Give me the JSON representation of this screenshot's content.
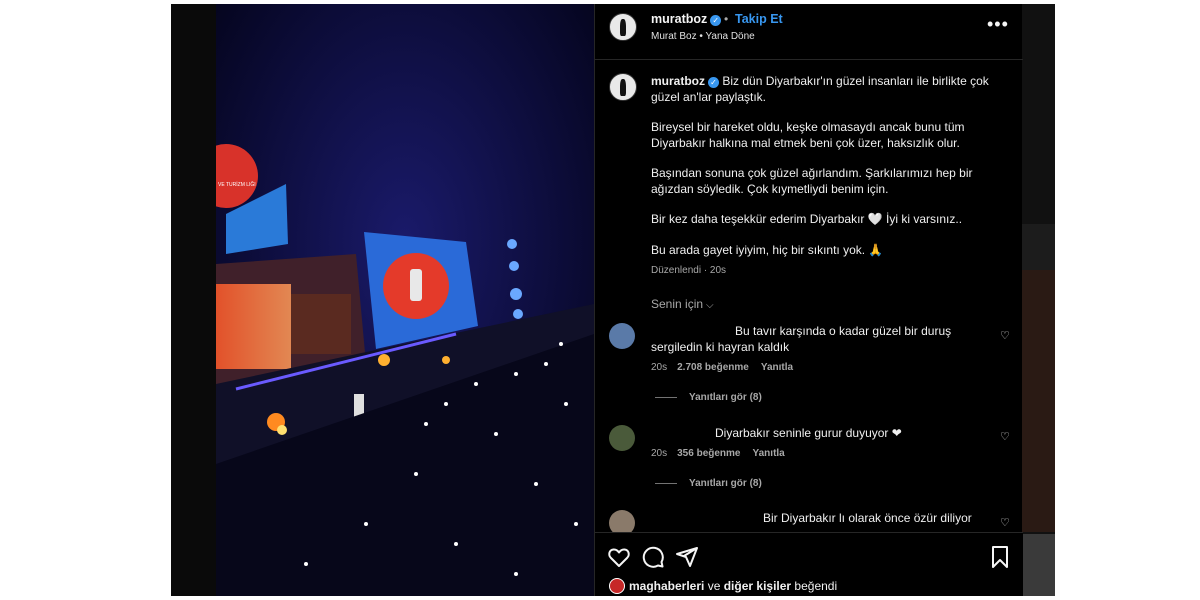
{
  "post": {
    "username": "muratboz",
    "follow_label": "Takip Et",
    "header_sub": "Murat Boz • Yana Döne",
    "more_label": "•••"
  },
  "caption": {
    "username": "muratboz",
    "paragraphs": [
      "Biz dün Diyarbakır'ın güzel insanları ile birlikte çok güzel an'lar paylaştık.",
      "Bireysel bir hareket oldu, keşke olmasaydı ancak bunu tüm Diyarbakır halkına mal etmek beni çok üzer, haksızlık olur.",
      "Başından sonuna çok güzel ağırlandım. Şarkılarımızı hep bir ağızdan söyledik. Çok kıymetliydi benim için.",
      "Bir kez daha teşekkür ederim Diyarbakır 🤍 İyi ki varsınız..",
      "Bu arada gayet iyiyim, hiç bir sıkıntı yok. 🙏"
    ],
    "meta": "Düzenlendi · 20s"
  },
  "sort_label": "Senin için",
  "comments": [
    {
      "text": "Bu tavır karşında o kadar güzel bir duruş sergiledin ki hayran kaldık",
      "time": "20s",
      "likes": "2.708 beğenme",
      "reply": "Yanıtla",
      "view_replies": "Yanıtları gör (8)"
    },
    {
      "text": "Diyarbakır seninle gurur duyuyor ❤",
      "time": "20s",
      "likes": "356 beğenme",
      "reply": "Yanıtla",
      "view_replies": "Yanıtları gör (8)"
    },
    {
      "text": "Bir Diyarbakır lı olarak önce özür diliyor"
    }
  ],
  "liked_by": {
    "user": "maghaberleri",
    "connector": " ve ",
    "others": "diğer kişiler",
    "suffix": " beğendi"
  },
  "media": {
    "screen_text": "VE TURİZM LIĞI"
  },
  "colors": {
    "accent": "#3897f0",
    "panel_bg": "#000000",
    "divider": "#262626"
  },
  "icons": [
    "verified-badge-icon",
    "more-options-icon",
    "chevron-down-icon",
    "heart-icon",
    "comment-icon",
    "share-icon",
    "bookmark-icon"
  ]
}
